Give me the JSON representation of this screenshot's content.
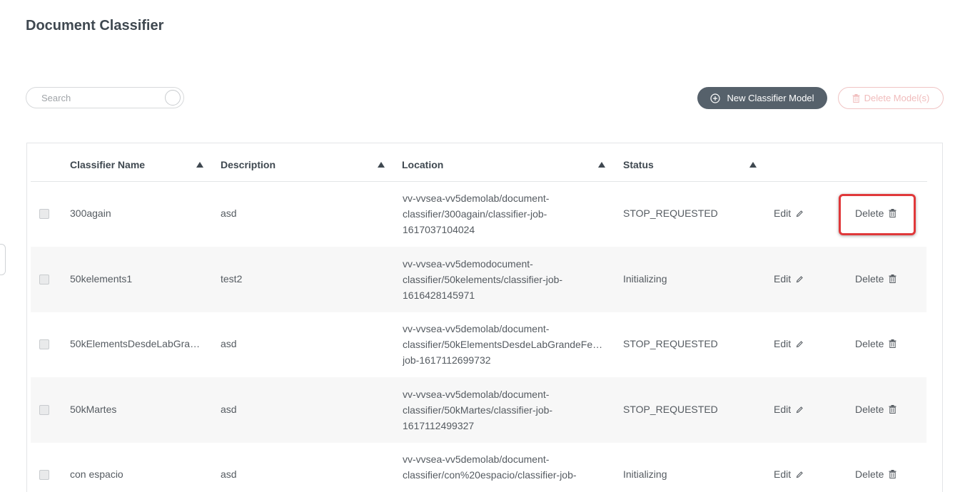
{
  "page": {
    "title": "Document Classifier"
  },
  "toolbar": {
    "search_placeholder": "Search",
    "new_model_label": "New Classifier Model",
    "delete_models_label": "Delete Model(s)"
  },
  "table": {
    "columns": [
      "Classifier Name",
      "Description",
      "Location",
      "Status"
    ],
    "edit_label": "Edit",
    "delete_label": "Delete",
    "rows": [
      {
        "name": "300again",
        "description": "asd",
        "location": [
          "vv-vvsea-vv5demolab/document-",
          "classifier/300again/classifier-job-",
          "1617037104024"
        ],
        "status": "STOP_REQUESTED"
      },
      {
        "name": "50kelements1",
        "description": "test2",
        "location": [
          "vv-vvsea-vv5demodocument-",
          "classifier/50kelements/classifier-job-",
          "1616428145971"
        ],
        "status": "Initializing"
      },
      {
        "name": "50kElementsDesdeLabGra…",
        "description": "asd",
        "location": [
          "vv-vvsea-vv5demolab/document-",
          "classifier/50kElementsDesdeLabGrandeFe…",
          "job-1617112699732"
        ],
        "status": "STOP_REQUESTED"
      },
      {
        "name": "50kMartes",
        "description": "asd",
        "location": [
          "vv-vvsea-vv5demolab/document-",
          "classifier/50kMartes/classifier-job-",
          "1617112499327"
        ],
        "status": "STOP_REQUESTED"
      },
      {
        "name": "con espacio",
        "description": "asd",
        "location": [
          "vv-vvsea-vv5demolab/document-",
          "classifier/con%20espacio/classifier-job-",
          ""
        ],
        "status": "Initializing"
      }
    ]
  },
  "colors": {
    "primary_button": "#56616b",
    "danger_outline": "#f0c4c4",
    "highlight": "#e0383a"
  }
}
